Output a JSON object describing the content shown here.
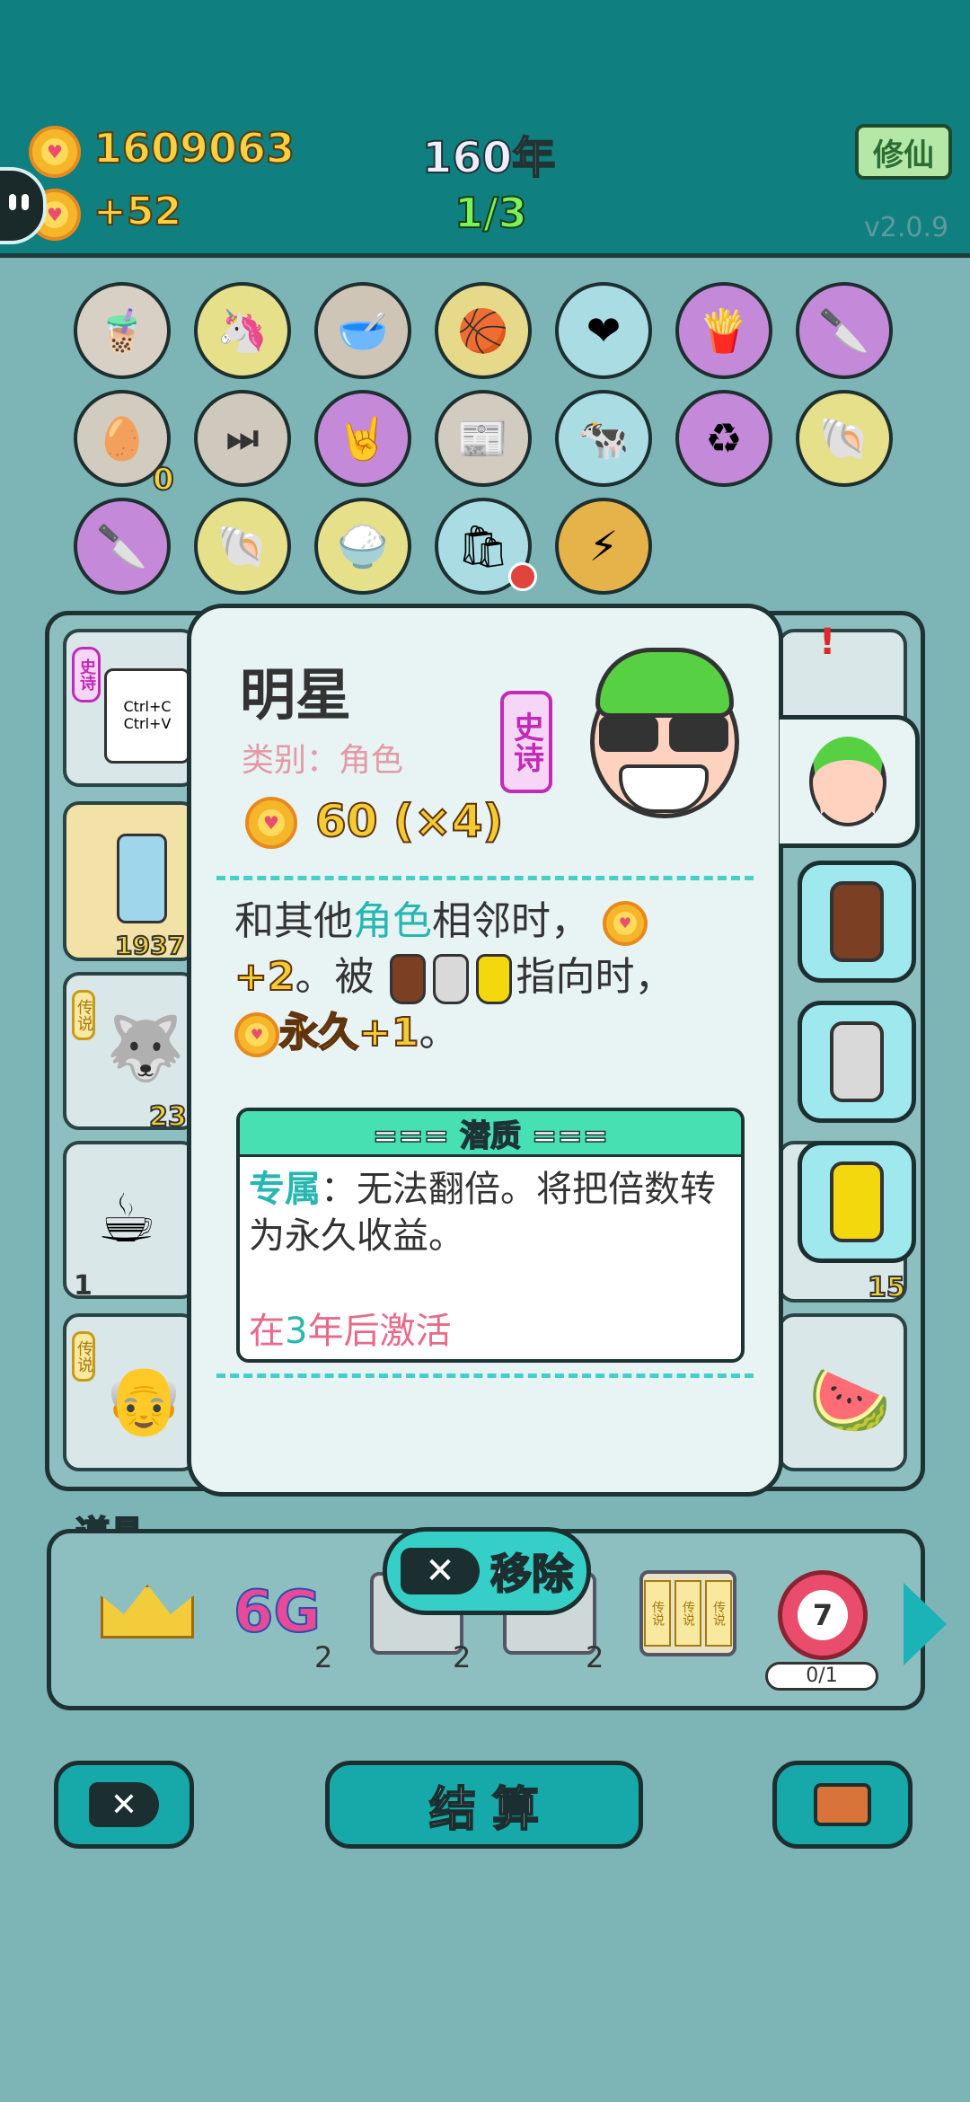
{
  "header": {
    "coins": "1609063",
    "income": "+52",
    "year": "160年",
    "progress": "1/3",
    "cultivate_button": "修仙",
    "version": "v2.0.9"
  },
  "board": {
    "row1_icons": [
      "bubble-tea-icon",
      "unicorn-icon",
      "dog-bowl-icon",
      "basketballs-icon",
      "heart-sign-icon",
      "fries-icon",
      "cleaver-icon"
    ],
    "row2_icons": [
      "egg-tray-icon",
      "skip-icon",
      "rock-hand-icon",
      "time-magazine-icon",
      "cows-icon",
      "recycle-icon",
      "shell-icon"
    ],
    "row3_icons": [
      "cleaver-icon",
      "shell-icon",
      "rice-bowl-icon",
      "garbage-bag-icon",
      "lightning-icon"
    ],
    "egg_tray_count": "0"
  },
  "grid_cards": {
    "ctrl_card_tag": "史诗",
    "ctrl_card_line1": "Ctrl+C",
    "ctrl_card_line2": "Ctrl+V",
    "fridge_count": "1937",
    "husky_tag": "传说",
    "husky_count": "23",
    "coffee_count": "1",
    "grandpa_tag": "传说",
    "right_count": "15"
  },
  "popup": {
    "name": "明星",
    "rarity": "史诗",
    "category_label": "类别：角色",
    "value": "60 (×4)",
    "desc": {
      "p1": "和其他",
      "p2": "角色",
      "p3": "相邻时，",
      "p4": "+2",
      "p5": "。被",
      "p6": "指向时，",
      "p7": "永久+1",
      "p8": "。"
    },
    "potential_title": "=== 潜质 ===",
    "potential_key": "专属",
    "potential_text": "：无法翻倍。将把倍数转为永久收益。",
    "activation_prefix": "在",
    "activation_num": "3",
    "activation_suffix": "年后激活"
  },
  "items": {
    "title": "道具",
    "remove_label": "移除",
    "item_6g": "6G",
    "count_a": "2",
    "count_b": "2",
    "count_c": "2",
    "target_number": "7",
    "target_progress": "0/1",
    "legend_tag": "传说"
  },
  "bottom": {
    "settle_label": "结 算"
  },
  "colors": {
    "header_bg": "#0f7f80",
    "board_bg": "#7db4b6",
    "accent_cyan": "#27b7b1",
    "gold": "#f3cb33",
    "epic_magenta": "#c12bb6",
    "activation_pink": "#e86a8a"
  }
}
